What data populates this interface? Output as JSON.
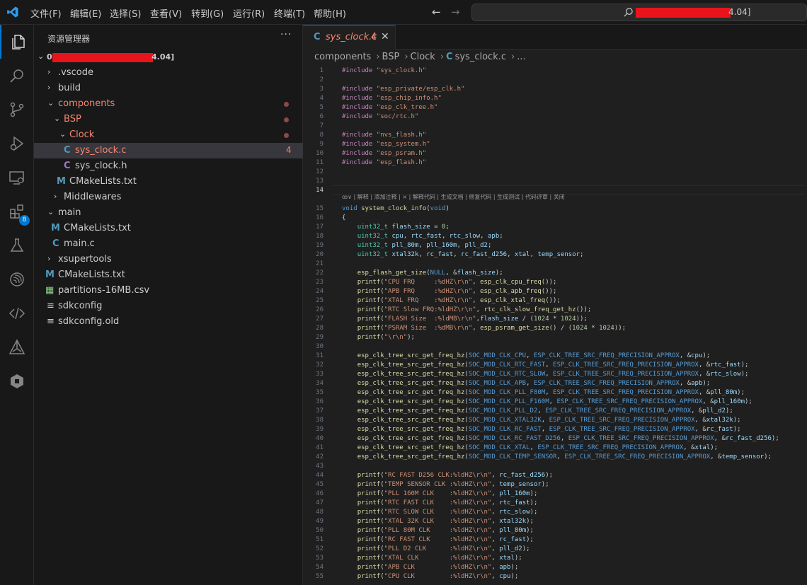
{
  "menu": [
    "文件(F)",
    "编辑(E)",
    "选择(S)",
    "查看(V)",
    "转到(G)",
    "运行(R)",
    "终端(T)",
    "帮助(H)"
  ],
  "search": {
    "visible_suffix": "4.04]"
  },
  "colors": {
    "accent": "#0078d4",
    "error": "#f48771",
    "folder_open": "#f48771",
    "c_icon": "#519aba",
    "keyword": "#569cd6",
    "string": "#ce9178",
    "function": "#dcdcaa",
    "type": "#4ec9b0",
    "variable": "#9cdcfe",
    "preproc": "#c586c0",
    "number": "#b5cea8"
  },
  "activity_bar": {
    "icons": [
      "explorer-icon",
      "search-icon",
      "source-control-icon",
      "run-debug-icon",
      "remote-explorer-icon",
      "extensions-icon",
      "testing-icon",
      "espressif-icon",
      "code-tag-icon",
      "cmake-icon",
      "docker-icon"
    ],
    "extensions_badge": "8"
  },
  "sidebar": {
    "title": "资源管理器",
    "more": "···",
    "root_visible_prefix": "0",
    "root_visible_suffix": "4.04]",
    "tree": [
      {
        "label": "build",
        "icon": "",
        "twisty": "›",
        "depth": 1
      },
      {
        "label": ".vscode",
        "icon": "",
        "twisty": "›",
        "depth": 1
      },
      {
        "label": "components",
        "icon": "",
        "twisty": "⌄",
        "depth": 1,
        "modified": true
      },
      {
        "label": "BSP",
        "icon": "",
        "twisty": "⌄",
        "depth": 2,
        "modified": true
      },
      {
        "label": "Clock",
        "icon": "",
        "twisty": "⌄",
        "depth": 3,
        "modified": true
      },
      {
        "label": "sys_clock.c",
        "icon": "C",
        "twisty": "",
        "depth": 4,
        "errors": "4",
        "selected": true
      },
      {
        "label": "sys_clock.h",
        "icon": "C",
        "twisty": "",
        "depth": 4
      },
      {
        "label": "CMakeLists.txt",
        "icon": "M",
        "twisty": "",
        "depth": 3
      },
      {
        "label": "Middlewares",
        "icon": "",
        "twisty": "›",
        "depth": 3
      },
      {
        "label": "main",
        "icon": "",
        "twisty": "⌄",
        "depth": 1
      },
      {
        "label": "CMakeLists.txt",
        "icon": "M",
        "twisty": "",
        "depth": 2
      },
      {
        "label": "main.c",
        "icon": "C",
        "twisty": "",
        "depth": 2
      },
      {
        "label": "xsupertools",
        "icon": "",
        "twisty": "›",
        "depth": 1
      },
      {
        "label": "CMakeLists.txt",
        "icon": "M",
        "twisty": "",
        "depth": 1
      },
      {
        "label": "partitions-16MB.csv",
        "icon": "▦",
        "twisty": "",
        "depth": 1
      },
      {
        "label": "sdkconfig",
        "icon": "≡",
        "twisty": "",
        "depth": 1
      },
      {
        "label": "sdkconfig.old",
        "icon": "≡",
        "twisty": "",
        "depth": 1
      }
    ]
  },
  "tab": {
    "icon": "C",
    "label": "sys_clock.c",
    "problems": "4",
    "close": "✕"
  },
  "breadcrumb": [
    "components",
    "BSP",
    "Clock",
    "sys_clock.c",
    "..."
  ],
  "codelens": "ꝏ∨ | 解释 | 添加注释 | × | 解释代码 | 生成文档 | 修复代码 | 生成测试 | 代码评审 | 关闭",
  "code": [
    {
      "n": "1",
      "t": "#include \"sys_clock.h\""
    },
    {
      "n": "2",
      "t": ""
    },
    {
      "n": "3",
      "t": "#include \"esp_private/esp_clk.h\""
    },
    {
      "n": "4",
      "t": "#include \"esp_chip_info.h\""
    },
    {
      "n": "5",
      "t": "#include \"esp_clk_tree.h\""
    },
    {
      "n": "6",
      "t": "#include \"soc/rtc.h\""
    },
    {
      "n": "7",
      "t": ""
    },
    {
      "n": "8",
      "t": "#include \"nvs_flash.h\""
    },
    {
      "n": "9",
      "t": "#include \"esp_system.h\""
    },
    {
      "n": "10",
      "t": "#include \"esp_psram.h\""
    },
    {
      "n": "11",
      "t": "#include \"esp_flash.h\""
    },
    {
      "n": "12",
      "t": ""
    },
    {
      "n": "13",
      "t": ""
    },
    {
      "n": "14",
      "t": ""
    },
    {
      "n": "15",
      "t": "void system_clock_info(void)"
    },
    {
      "n": "16",
      "t": "{"
    },
    {
      "n": "17",
      "t": "    uint32_t flash_size = 0;"
    },
    {
      "n": "18",
      "t": "    uint32_t cpu, rtc_fast, rtc_slow, apb;"
    },
    {
      "n": "19",
      "t": "    uint32_t pll_80m, pll_160m, pll_d2;"
    },
    {
      "n": "20",
      "t": "    uint32_t xtal32k, rc_fast, rc_fast_d256, xtal, temp_sensor;"
    },
    {
      "n": "21",
      "t": ""
    },
    {
      "n": "22",
      "t": "    esp_flash_get_size(NULL, &flash_size);"
    },
    {
      "n": "23",
      "t": "    printf(\"CPU FRQ     :%dHZ\\r\\n\", esp_clk_cpu_freq());"
    },
    {
      "n": "24",
      "t": "    printf(\"APB FRQ     :%dHZ\\r\\n\", esp_clk_apb_freq());"
    },
    {
      "n": "25",
      "t": "    printf(\"XTAL FRQ    :%dHZ\\r\\n\", esp_clk_xtal_freq());"
    },
    {
      "n": "26",
      "t": "    printf(\"RTC Slow FRQ:%ldHZ\\r\\n\", rtc_clk_slow_freq_get_hz());"
    },
    {
      "n": "27",
      "t": "    printf(\"FLASH Size  :%ldMB\\r\\n\",flash_size / (1024 * 1024));"
    },
    {
      "n": "28",
      "t": "    printf(\"PSRAM Size  :%dMB\\r\\n\", esp_psram_get_size() / (1024 * 1024));"
    },
    {
      "n": "29",
      "t": "    printf(\"\\r\\n\");"
    },
    {
      "n": "30",
      "t": ""
    },
    {
      "n": "31",
      "t": "    esp_clk_tree_src_get_freq_hz(SOC_MOD_CLK_CPU, ESP_CLK_TREE_SRC_FREQ_PRECISION_APPROX, &cpu);"
    },
    {
      "n": "32",
      "t": "    esp_clk_tree_src_get_freq_hz(SOC_MOD_CLK_RTC_FAST, ESP_CLK_TREE_SRC_FREQ_PRECISION_APPROX, &rtc_fast);"
    },
    {
      "n": "33",
      "t": "    esp_clk_tree_src_get_freq_hz(SOC_MOD_CLK_RTC_SLOW, ESP_CLK_TREE_SRC_FREQ_PRECISION_APPROX, &rtc_slow);"
    },
    {
      "n": "34",
      "t": "    esp_clk_tree_src_get_freq_hz(SOC_MOD_CLK_APB, ESP_CLK_TREE_SRC_FREQ_PRECISION_APPROX, &apb);"
    },
    {
      "n": "35",
      "t": "    esp_clk_tree_src_get_freq_hz(SOC_MOD_CLK_PLL_F80M, ESP_CLK_TREE_SRC_FREQ_PRECISION_APPROX, &pll_80m);"
    },
    {
      "n": "36",
      "t": "    esp_clk_tree_src_get_freq_hz(SOC_MOD_CLK_PLL_F160M, ESP_CLK_TREE_SRC_FREQ_PRECISION_APPROX, &pll_160m);"
    },
    {
      "n": "37",
      "t": "    esp_clk_tree_src_get_freq_hz(SOC_MOD_CLK_PLL_D2, ESP_CLK_TREE_SRC_FREQ_PRECISION_APPROX, &pll_d2);"
    },
    {
      "n": "38",
      "t": "    esp_clk_tree_src_get_freq_hz(SOC_MOD_CLK_XTAL32K, ESP_CLK_TREE_SRC_FREQ_PRECISION_APPROX, &xtal32k);"
    },
    {
      "n": "39",
      "t": "    esp_clk_tree_src_get_freq_hz(SOC_MOD_CLK_RC_FAST, ESP_CLK_TREE_SRC_FREQ_PRECISION_APPROX, &rc_fast);"
    },
    {
      "n": "40",
      "t": "    esp_clk_tree_src_get_freq_hz(SOC_MOD_CLK_RC_FAST_D256, ESP_CLK_TREE_SRC_FREQ_PRECISION_APPROX, &rc_fast_d256);"
    },
    {
      "n": "41",
      "t": "    esp_clk_tree_src_get_freq_hz(SOC_MOD_CLK_XTAL, ESP_CLK_TREE_SRC_FREQ_PRECISION_APPROX, &xtal);"
    },
    {
      "n": "42",
      "t": "    esp_clk_tree_src_get_freq_hz(SOC_MOD_CLK_TEMP_SENSOR, ESP_CLK_TREE_SRC_FREQ_PRECISION_APPROX, &temp_sensor);"
    },
    {
      "n": "43",
      "t": ""
    },
    {
      "n": "44",
      "t": "    printf(\"RC FAST D256 CLK:%ldHZ\\r\\n\", rc_fast_d256);"
    },
    {
      "n": "45",
      "t": "    printf(\"TEMP SENSOR CLK :%ldHZ\\r\\n\", temp_sensor);"
    },
    {
      "n": "46",
      "t": "    printf(\"PLL 160M CLK    :%ldHZ\\r\\n\", pll_160m);"
    },
    {
      "n": "47",
      "t": "    printf(\"RTC FAST CLK    :%ldHZ\\r\\n\", rtc_fast);"
    },
    {
      "n": "48",
      "t": "    printf(\"RTC SLOW CLK    :%ldHZ\\r\\n\", rtc_slow);"
    },
    {
      "n": "49",
      "t": "    printf(\"XTAL 32K CLK    :%ldHZ\\r\\n\", xtal32k);"
    },
    {
      "n": "50",
      "t": "    printf(\"PLL 80M CLK     :%ldHZ\\r\\n\", pll_80m);"
    },
    {
      "n": "51",
      "t": "    printf(\"RC FAST CLK     :%ldHZ\\r\\n\", rc_fast);"
    },
    {
      "n": "52",
      "t": "    printf(\"PLL D2 CLK      :%ldHZ\\r\\n\", pll_d2);"
    },
    {
      "n": "53",
      "t": "    printf(\"XTAL CLK        :%ldHZ\\r\\n\", xtal);"
    },
    {
      "n": "54",
      "t": "    printf(\"APB CLK         :%ldHZ\\r\\n\", apb);"
    },
    {
      "n": "55",
      "t": "    printf(\"CPU CLK         :%ldHZ\\r\\n\", cpu);"
    }
  ]
}
